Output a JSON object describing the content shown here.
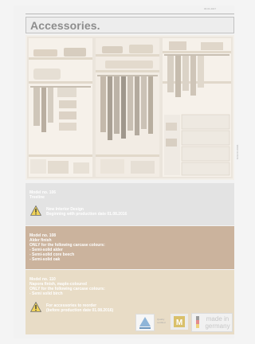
{
  "document": {
    "page_code": "03.01.2017",
    "title": "Accessories.",
    "vertical_code": "M 02.01.0006",
    "sections": [
      {
        "lines": [
          "Model no. 106",
          "Treeline"
        ],
        "notice": [
          "New Interior Design",
          "Beginning with production date 01.08.2016"
        ]
      },
      {
        "lines": [
          "Model no. 108",
          "Alder finish",
          "ONLY for the following carcase colours:",
          "- Semi-solid alder",
          "- Semi-solid core beech",
          "- Semi-solid oak"
        ]
      },
      {
        "lines": [
          "Model no. 110",
          "Napora finish, maple-coloured",
          "ONLY for the following carcase colours:",
          "- Semi solid birch"
        ],
        "notice": [
          "For accessories to reorder",
          "(before production date 01.08.2016)"
        ]
      }
    ],
    "logos": {
      "cert_label": [
        "Quality",
        "certified"
      ],
      "made_in": [
        "made in",
        "germany"
      ]
    }
  },
  "colors": {
    "band1": "#e3e3e3",
    "band2": "#cbb39d",
    "band3": "#e8dcc6",
    "warning": "#f0d35a"
  }
}
